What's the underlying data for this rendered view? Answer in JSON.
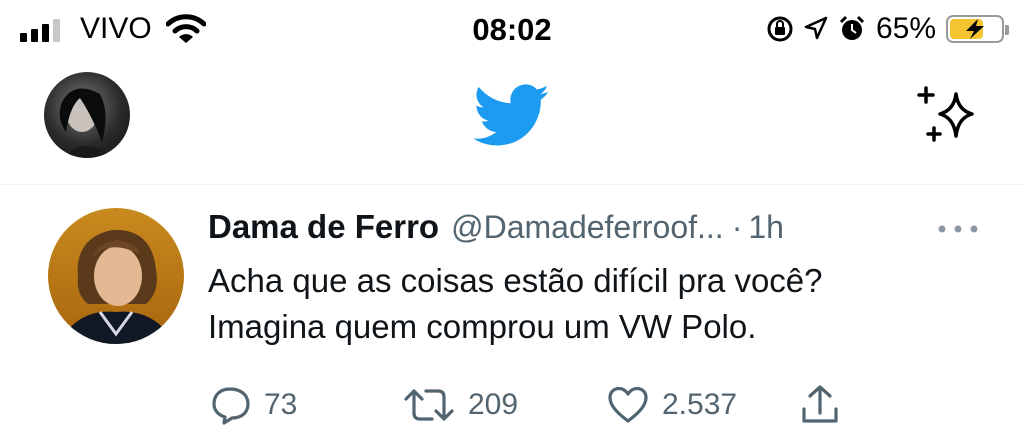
{
  "status_bar": {
    "carrier": "VIVO",
    "time": "08:02",
    "battery_percent": "65%",
    "battery_level": 0.65,
    "signal_bars_active": 3,
    "signal_bars_total": 4,
    "icons": [
      "signal-icon",
      "wifi-icon",
      "rotation-lock-icon",
      "location-icon",
      "alarm-icon",
      "battery-charging-icon"
    ]
  },
  "header": {
    "logo": "twitter-bird-icon",
    "sparkle": "sparkle-icon",
    "brand_color": "#1d9bf0"
  },
  "tweet": {
    "display_name": "Dama de Ferro",
    "handle": "@Damadeferroof...",
    "separator": "·",
    "time": "1h",
    "text_lines": [
      "Acha que as coisas estão difícil pra você?",
      "Imagina quem comprou um VW Polo."
    ],
    "actions": {
      "replies": "73",
      "retweets": "209",
      "likes": "2.537"
    }
  },
  "colors": {
    "text_primary": "#0f1419",
    "text_secondary": "#536471",
    "battery_fill": "#f4c531"
  }
}
